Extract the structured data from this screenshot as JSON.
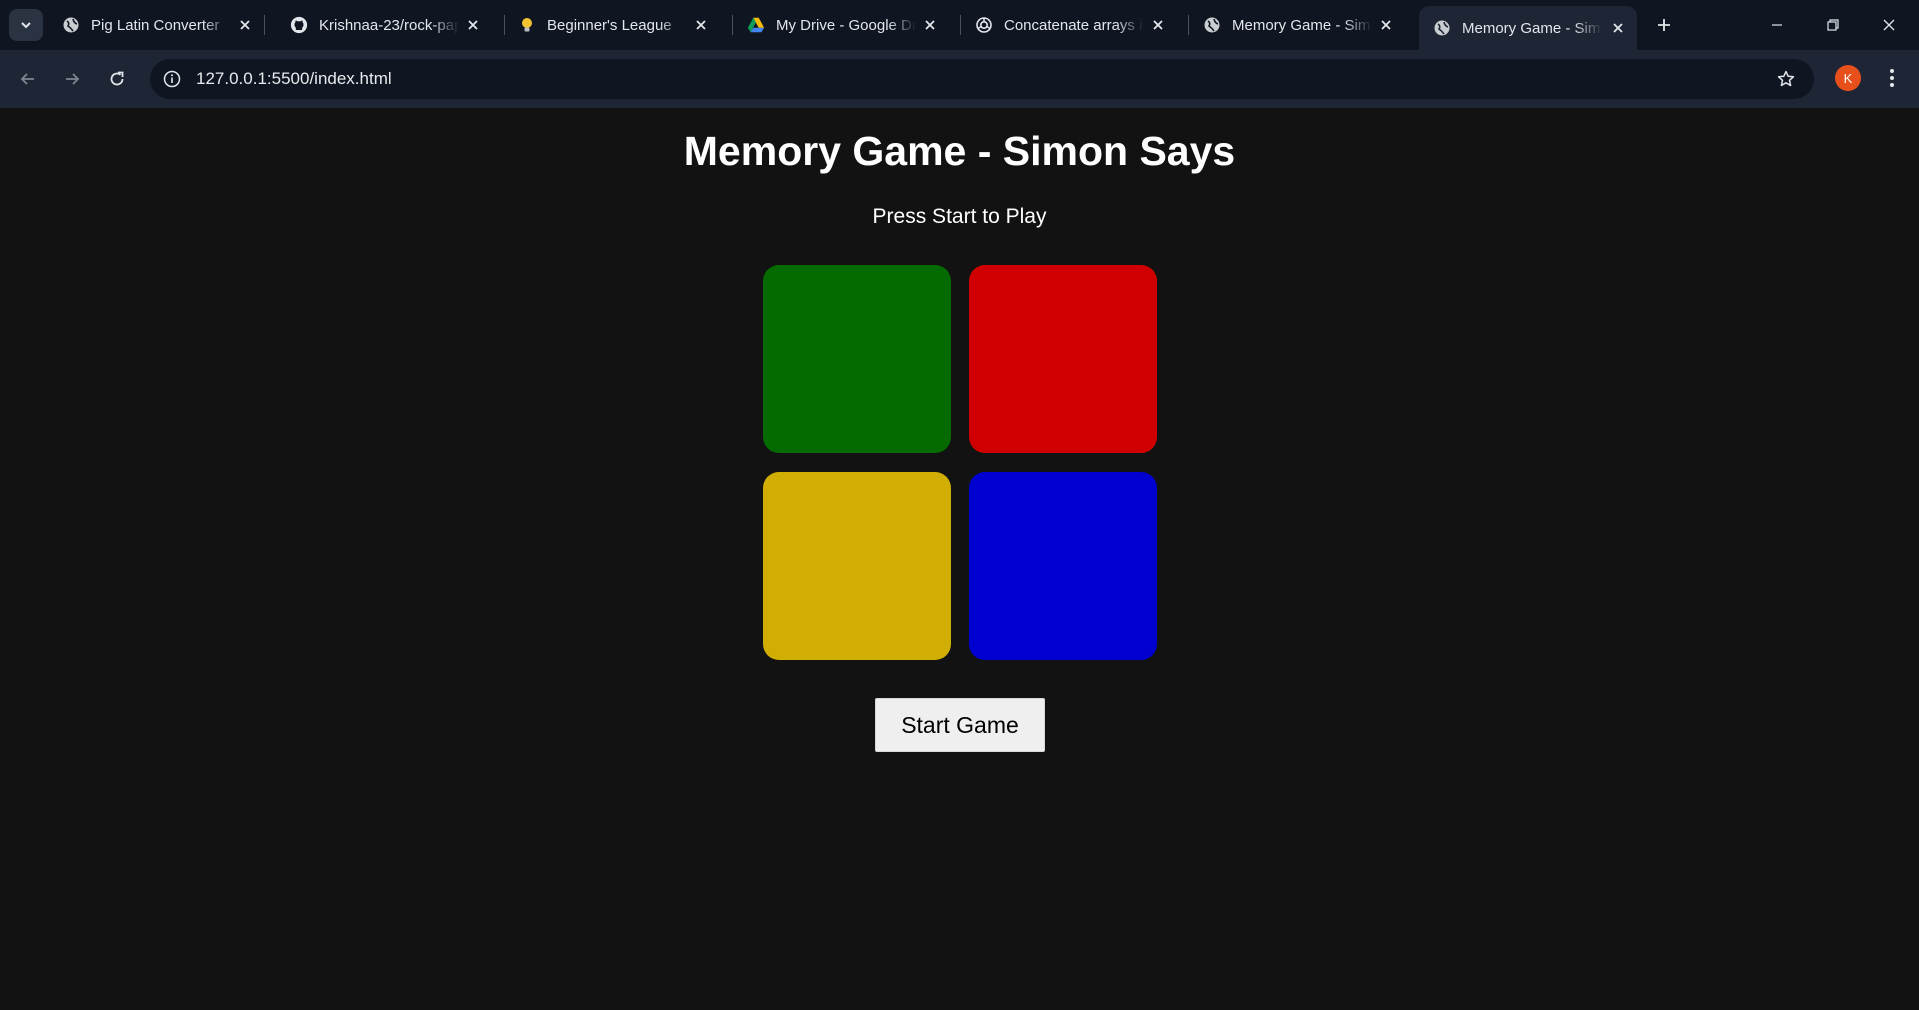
{
  "browser": {
    "tabs": [
      {
        "title": "Pig Latin Converter",
        "icon": "globe-icon",
        "active": false
      },
      {
        "title": "Krishnaa-23/rock-pap",
        "icon": "github-icon",
        "active": false
      },
      {
        "title": "Beginner's League",
        "icon": "lightbulb-icon",
        "active": false
      },
      {
        "title": "My Drive - Google Dr",
        "icon": "google-drive-icon",
        "active": false
      },
      {
        "title": "Concatenate arrays in",
        "icon": "openai-icon",
        "active": false
      },
      {
        "title": "Memory Game - Simo",
        "icon": "globe-icon",
        "active": false
      },
      {
        "title": "Memory Game - Simo",
        "icon": "globe-icon",
        "active": true
      }
    ],
    "url": "127.0.0.1:5500/index.html",
    "profile_initial": "K",
    "accent_color": "#e8501b"
  },
  "game": {
    "title": "Memory Game - Simon Says",
    "status": "Press Start to Play",
    "pads": [
      {
        "name": "green",
        "color": "#056a00"
      },
      {
        "name": "red",
        "color": "#d00000"
      },
      {
        "name": "yellow",
        "color": "#d0ae03"
      },
      {
        "name": "blue",
        "color": "#0000d0"
      }
    ],
    "start_label": "Start Game"
  }
}
